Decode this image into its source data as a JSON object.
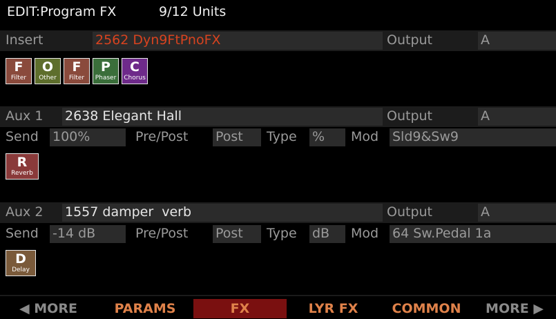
{
  "header": {
    "title": "EDIT:Program FX",
    "units": "9/12 Units"
  },
  "insert": {
    "label": "Insert",
    "value": "2562 Dyn9FtPnoFX",
    "output_label": "Output",
    "output_value": "A",
    "chain": [
      {
        "letter": "F",
        "name": "Filter",
        "color": "#8a4a3c"
      },
      {
        "letter": "O",
        "name": "Other",
        "color": "#5e6e2c"
      },
      {
        "letter": "F",
        "name": "Filter",
        "color": "#8a4a3c"
      },
      {
        "letter": "P",
        "name": "Phaser",
        "color": "#3a6e3a"
      },
      {
        "letter": "C",
        "name": "Chorus",
        "color": "#6e2a8a"
      }
    ]
  },
  "aux1": {
    "label": "Aux 1",
    "value": "2638 Elegant Hall",
    "output_label": "Output",
    "output_value": "A",
    "send_label": "Send",
    "send_value": "100%",
    "prepost_label": "Pre/Post",
    "prepost_value": "Post",
    "type_label": "Type",
    "type_value": "%",
    "mod_label": "Mod",
    "mod_value": "Sld9&Sw9",
    "chain": [
      {
        "letter": "R",
        "name": "Reverb",
        "color": "#8a3a3a"
      }
    ]
  },
  "aux2": {
    "label": "Aux 2",
    "value": "1557 damper  verb",
    "output_label": "Output",
    "output_value": "A",
    "send_label": "Send",
    "send_value": "-14 dB",
    "prepost_label": "Pre/Post",
    "prepost_value": "Post",
    "type_label": "Type",
    "type_value": "dB",
    "mod_label": "Mod",
    "mod_value": "64 Sw.Pedal 1a",
    "chain": [
      {
        "letter": "D",
        "name": "Delay",
        "color": "#7a5a3a"
      }
    ]
  },
  "footer": {
    "tabs": [
      {
        "label": "◀ MORE",
        "color": "#8a8a8a"
      },
      {
        "label": "PARAMS",
        "color": "#e0824a"
      },
      {
        "label": "FX",
        "color": "#e0824a"
      },
      {
        "label": "LYR FX",
        "color": "#e0824a"
      },
      {
        "label": "COMMON",
        "color": "#e0824a"
      },
      {
        "label": "MORE ▶",
        "color": "#8a8a8a"
      }
    ],
    "active_tab": "FX"
  }
}
